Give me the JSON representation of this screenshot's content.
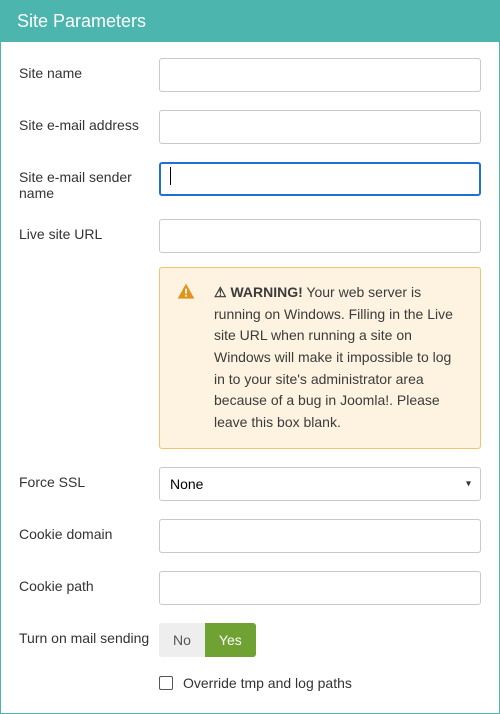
{
  "header": {
    "title": "Site Parameters"
  },
  "fields": {
    "site_name": {
      "label": "Site name",
      "value": ""
    },
    "site_email": {
      "label": "Site e-mail address",
      "value": ""
    },
    "sender_name": {
      "label": "Site e-mail sender name",
      "value": ""
    },
    "live_site_url": {
      "label": "Live site URL",
      "value": ""
    },
    "force_ssl": {
      "label": "Force SSL",
      "value": "None",
      "options": [
        "None"
      ]
    },
    "cookie_domain": {
      "label": "Cookie domain",
      "value": ""
    },
    "cookie_path": {
      "label": "Cookie path",
      "value": ""
    },
    "mail_sending": {
      "label": "Turn on mail sending",
      "no": "No",
      "yes": "Yes",
      "value": "Yes"
    },
    "override_paths": {
      "label": "Override tmp and log paths",
      "checked": false
    }
  },
  "warning": {
    "prefix": "WARNING!",
    "text": " Your web server is running on Windows. Filling in the Live site URL when running a site on Windows will make it impossible to log in to your site's administrator area because of a bug in Joomla!. Please leave this box blank."
  }
}
